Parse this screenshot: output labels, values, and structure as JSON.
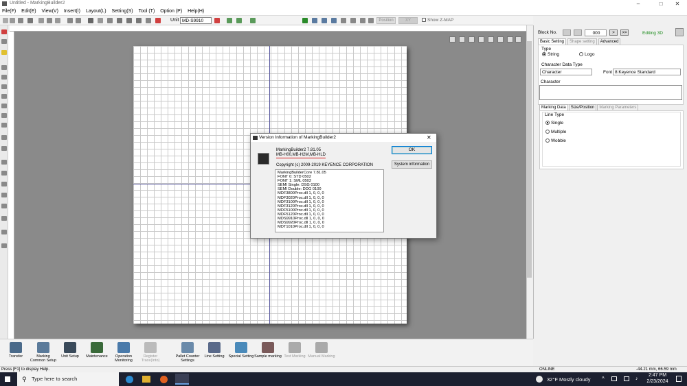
{
  "window": {
    "title": "Untitled - MarkingBuilder2"
  },
  "menu": [
    "File(F)",
    "Edit(E)",
    "View(V)",
    "Insert(I)",
    "Layout(L)",
    "Setting(S)",
    "Tool (T)",
    "Option (P)",
    "Help(H)"
  ],
  "toolbar": {
    "unit_label": "Unit",
    "unit_value": "MD-S9910",
    "position_label": "Position",
    "xy_label": "XY",
    "zmap_label": "Show Z-MAP",
    "show_zmap": false
  },
  "right_panel": {
    "block_no_label": "Block No.",
    "block_no_value": "000",
    "editing_label": "Editing 3D",
    "tabs": [
      "Basic Setting",
      "Shape setting",
      "Advanced"
    ],
    "type_label": "Type",
    "type_options": [
      "String",
      "Logo"
    ],
    "type_selected": "String",
    "char_data_type_label": "Character Data Type",
    "char_data_type_value": "Character",
    "font_label": "Font",
    "font_value": "8:Keyence Standard",
    "character_label": "Character",
    "character_value": "",
    "subtabs": [
      "Marking Data",
      "Size/Position",
      "Marking Parameters"
    ],
    "line_type_label": "Line Type",
    "line_types": [
      "Single",
      "Multiple",
      "Wobble"
    ],
    "line_type_selected": "Single"
  },
  "bottom_buttons": [
    {
      "label": "Transfer",
      "enabled": true
    },
    {
      "label": "Marking Common Setup",
      "enabled": true
    },
    {
      "label": "Unit Setup",
      "enabled": true
    },
    {
      "label": "Maintenance",
      "enabled": true
    },
    {
      "label": "Operation Monitoring",
      "enabled": true
    },
    {
      "label": "Register Trace(Into)",
      "enabled": false
    },
    {
      "label": "Pallet Counter Settings",
      "enabled": true
    },
    {
      "label": "Line Setting",
      "enabled": true
    },
    {
      "label": "Special Setting",
      "enabled": true
    },
    {
      "label": "Sample marking",
      "enabled": true
    },
    {
      "label": "Test Marking",
      "enabled": false
    },
    {
      "label": "Manual Marking",
      "enabled": false
    }
  ],
  "status": {
    "help": "Press [F1] to display Help.",
    "online": "ONLINE",
    "coords": "-44.21 mm, 66.59 mm"
  },
  "dialog": {
    "title": "Version Information of MarkingBuilder2",
    "product": "MarkingBuilder2 7.81.05",
    "models": "MB-H00,MB-H2M,MB-HLD",
    "copyright": "Copyright (c) 2009-2019 KEYENCE CORPORATION",
    "ok_label": "OK",
    "sysinfo_label": "System information",
    "components": [
      "MarkingBuilderCore 7.81.05",
      "FONT 0: STD 0502",
      "FONT 1: SML 0502",
      "SEMI Single: DSG 0100",
      "SEMI Double: DDG 0100",
      "MDF3800Proc.dll 1, 0, 0, 0",
      "MDF3020Proc.dll 1, 0, 0, 0",
      "MDF3100Proc.dll 1, 0, 0, 0",
      "MDF3120Proc.dll 1, 0, 0, 0",
      "MDF5100Proc.dll 1, 0, 0, 0",
      "MDF5120Proc.dll 1, 0, 0, 0",
      "MDS9910Proc.dll 1, 0, 0, 0",
      "MDS9920Proc.dll 1, 0, 0, 0",
      "MDT1010Proc.dll 1, 0, 0, 0"
    ]
  },
  "taskbar": {
    "search_placeholder": "Type here to search",
    "weather": "32°F  Mostly cloudy",
    "time": "2:47 PM",
    "date": "2/23/2024"
  }
}
